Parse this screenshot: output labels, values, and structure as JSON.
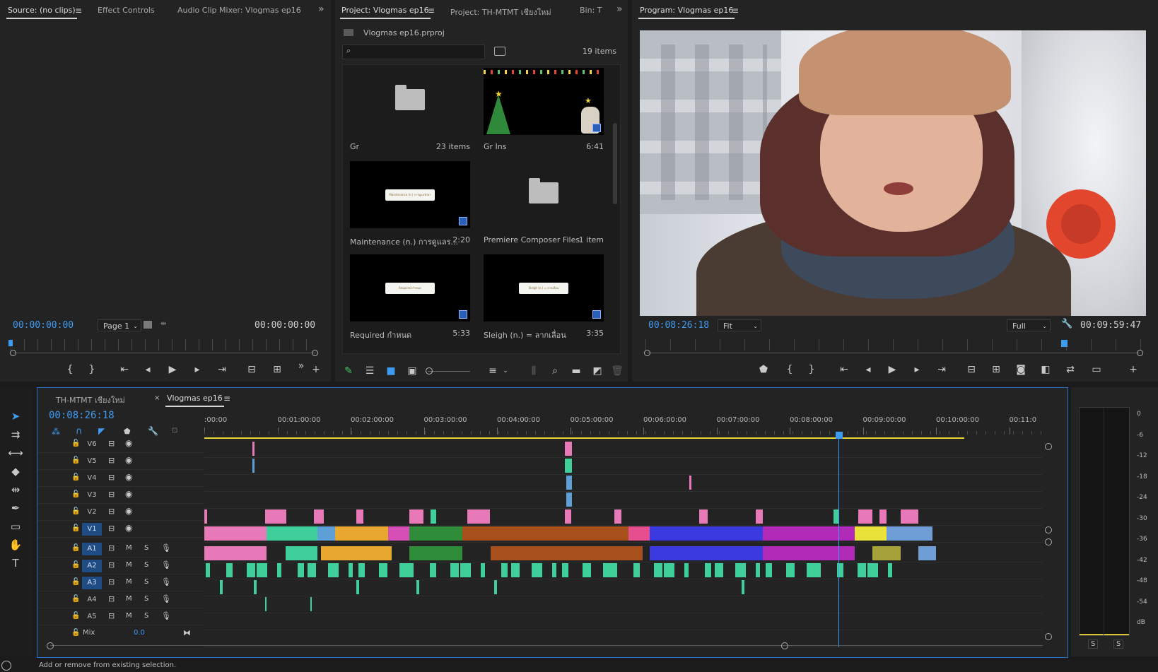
{
  "source_panel": {
    "tabs": [
      "Source: (no clips)",
      "Effect Controls",
      "Audio Clip Mixer: Vlogmas ep16"
    ],
    "overflow": "»",
    "timecode_in": "00:00:00:00",
    "timecode_out": "00:00:00:00",
    "page_select": "Page 1"
  },
  "project_panel": {
    "tabs": [
      "Project: Vlogmas ep16",
      "Project: TH-MTMT เชียงใหม่",
      "Bin: T"
    ],
    "overflow": "»",
    "file_name": "Vlogmas ep16.prproj",
    "search_placeholder": "",
    "item_count": "19 items",
    "items": [
      {
        "name": "Gr",
        "meta": "23 items",
        "kind": "folder"
      },
      {
        "name": "Gr Ins",
        "meta": "6:41",
        "kind": "video"
      },
      {
        "name": "Maintenance  (n.) การดูแลร...",
        "meta": "2:20",
        "kind": "video"
      },
      {
        "name": "Premiere Composer Files",
        "meta": "1 item",
        "kind": "folder"
      },
      {
        "name": "Required กำหนด",
        "meta": "5:33",
        "kind": "video"
      },
      {
        "name": "Sleigh (n.) = ลากเลื่อน",
        "meta": "3:35",
        "kind": "video"
      }
    ],
    "thumb_banner_texts": [
      "Maintenance (n.) การดูแลรักษา",
      "Required กำหนด",
      "Sleigh (n.) = ลากเลื่อน"
    ]
  },
  "program_panel": {
    "tab": "Program: Vlogmas ep16",
    "timecode_current": "00:08:26:18",
    "fit_select": "Fit",
    "quality_select": "Full",
    "timecode_duration": "00:09:59:47",
    "playhead_fraction": 0.844
  },
  "timeline": {
    "tabs": [
      "TH-MTMT เชียงใหม่",
      "Vlogmas ep16"
    ],
    "close_mark": "×",
    "timecode": "00:08:26:18",
    "ruler_labels": [
      ":00:00",
      "00:01:00:00",
      "00:02:00:00",
      "00:03:00:00",
      "00:04:00:00",
      "00:05:00:00",
      "00:06:00:00",
      "00:07:00:00",
      "00:08:00:00",
      "00:09:00:00",
      "00:10:00:00",
      "00:11:0"
    ],
    "video_tracks": [
      "V6",
      "V5",
      "V4",
      "V3",
      "V2",
      "V1"
    ],
    "audio_tracks": [
      "A1",
      "A2",
      "A3",
      "A4",
      "A5"
    ],
    "active_video": "V1",
    "active_audio": [
      "A1",
      "A2",
      "A3"
    ],
    "mute_label": "M",
    "solo_label": "S",
    "mix_label": "Mix",
    "mix_value": "0.0",
    "playhead_fraction": 0.757
  },
  "audio_meter": {
    "ticks": [
      "0",
      "-6",
      "-12",
      "-18",
      "-24",
      "-30",
      "-36",
      "-42",
      "-48",
      "-54",
      "dB"
    ],
    "solo_buttons": [
      "S",
      "S"
    ]
  },
  "status_bar": {
    "text": "Add or remove from existing selection."
  },
  "colors": {
    "accent": "#3f9bf2",
    "work_area": "#e8d631",
    "panel_bg": "#232323",
    "active_track": "#1e4c83"
  }
}
